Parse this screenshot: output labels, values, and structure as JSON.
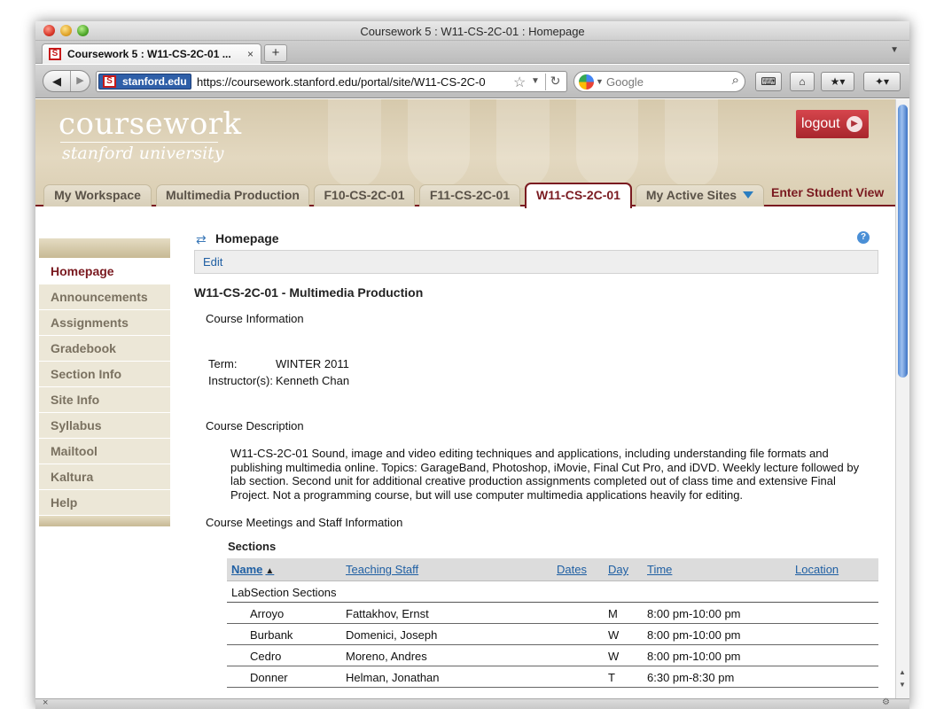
{
  "window": {
    "title": "Coursework 5 : W11-CS-2C-01 : Homepage"
  },
  "browser": {
    "tab_title": "Coursework 5 : W11-CS-2C-01 ...",
    "tab_close": "×",
    "new_tab": "+",
    "site_identity": "stanford.edu",
    "url": "https://coursework.stanford.edu/portal/site/W11-CS-2C-0",
    "search_placeholder": "Google"
  },
  "header": {
    "logo_main": "coursework",
    "logo_sub": "stanford university",
    "logout_label": "logout"
  },
  "site_tabs": [
    {
      "label": "My Workspace"
    },
    {
      "label": "Multimedia Production"
    },
    {
      "label": "F10-CS-2C-01"
    },
    {
      "label": "F11-CS-2C-01"
    },
    {
      "label": "W11-CS-2C-01",
      "active": true
    },
    {
      "label": "My Active Sites"
    }
  ],
  "student_view": "Enter Student View",
  "sidebar": {
    "items": [
      {
        "label": "Homepage",
        "current": true
      },
      {
        "label": "Announcements"
      },
      {
        "label": "Assignments"
      },
      {
        "label": "Gradebook"
      },
      {
        "label": "Section Info"
      },
      {
        "label": "Site Info"
      },
      {
        "label": "Syllabus"
      },
      {
        "label": "Mailtool"
      },
      {
        "label": "Kaltura"
      },
      {
        "label": "Help"
      }
    ]
  },
  "tool": {
    "title": "Homepage",
    "edit_label": "Edit",
    "help_label": "?"
  },
  "course": {
    "heading": "W11-CS-2C-01 - Multimedia Production",
    "info_heading": "Course Information",
    "term_label": "Term:",
    "term_value": "WINTER 2011",
    "instructor_label": "Instructor(s):",
    "instructor_value": "Kenneth Chan",
    "description_heading": "Course Description",
    "description": "W11-CS-2C-01 Sound, image and video editing techniques and applications, including understanding file formats and publishing multimedia online. Topics: GarageBand, Photoshop, iMovie, Final Cut Pro, and iDVD. Weekly lecture followed by lab section. Second unit for additional creative production assignments completed out of class time and extensive Final Project. Not a programming course, but will use computer multimedia applications heavily for editing.",
    "meetings_heading": "Course Meetings and Staff Information"
  },
  "sections": {
    "label": "Sections",
    "columns": [
      "Name",
      "Teaching Staff",
      "Dates",
      "Day",
      "Time",
      "Location"
    ],
    "group": "LabSection Sections",
    "rows": [
      {
        "name": "Arroyo",
        "staff": "Fattakhov, Ernst",
        "day": "M",
        "time": "8:00 pm-10:00 pm"
      },
      {
        "name": "Burbank",
        "staff": "Domenici, Joseph",
        "day": "W",
        "time": "8:00 pm-10:00 pm"
      },
      {
        "name": "Cedro",
        "staff": "Moreno, Andres",
        "day": "W",
        "time": "8:00 pm-10:00 pm"
      },
      {
        "name": "Donner",
        "staff": "Helman, Jonathan",
        "day": "T",
        "time": "6:30 pm-8:30 pm"
      }
    ]
  }
}
